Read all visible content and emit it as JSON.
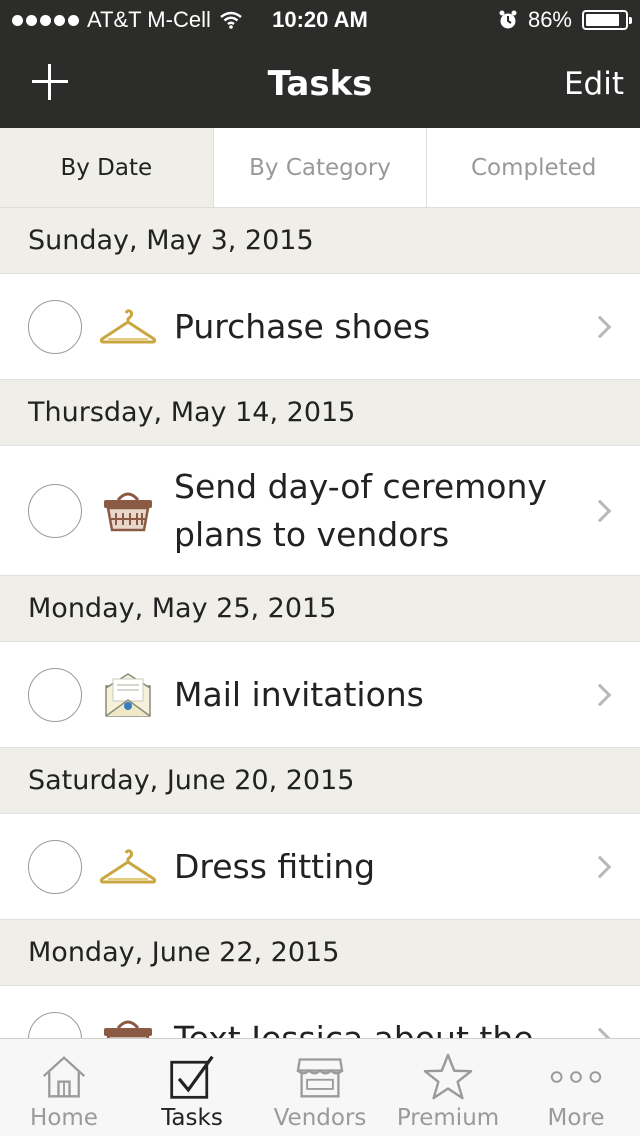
{
  "status_bar": {
    "carrier": "AT&T M-Cell",
    "time": "10:20 AM",
    "battery_percent": "86%",
    "battery_level": 0.86
  },
  "nav": {
    "title": "Tasks",
    "edit_label": "Edit",
    "add_icon": "plus-icon"
  },
  "tabs": [
    {
      "label": "By Date",
      "active": true
    },
    {
      "label": "By Category",
      "active": false
    },
    {
      "label": "Completed",
      "active": false
    }
  ],
  "sections": [
    {
      "date": "Sunday, May 3, 2015",
      "tasks": [
        {
          "title": "Purchase shoes",
          "icon": "hanger-icon"
        }
      ]
    },
    {
      "date": "Thursday, May 14, 2015",
      "tasks": [
        {
          "title": "Send day-of ceremony plans to vendors",
          "icon": "basket-icon"
        }
      ]
    },
    {
      "date": "Monday, May 25, 2015",
      "tasks": [
        {
          "title": "Mail invitations",
          "icon": "envelope-icon"
        }
      ]
    },
    {
      "date": "Saturday, June 20, 2015",
      "tasks": [
        {
          "title": "Dress fitting",
          "icon": "hanger-icon"
        }
      ]
    },
    {
      "date": "Monday, June 22, 2015",
      "tasks": [
        {
          "title": "Text Jessica about the",
          "icon": "basket-icon"
        }
      ]
    }
  ],
  "tab_bar": [
    {
      "label": "Home",
      "icon": "house-icon",
      "active": false
    },
    {
      "label": "Tasks",
      "icon": "checkbox-icon",
      "active": true
    },
    {
      "label": "Vendors",
      "icon": "storefront-icon",
      "active": false
    },
    {
      "label": "Premium",
      "icon": "star-icon",
      "active": false
    },
    {
      "label": "More",
      "icon": "more-dots-icon",
      "active": false
    }
  ],
  "colors": {
    "bar_dark": "#2c2c2a",
    "section_bg": "#efeee9",
    "icon_gold": "#c9a640",
    "icon_brown": "#8a5a44",
    "inactive_gray": "#9a9a9a"
  }
}
